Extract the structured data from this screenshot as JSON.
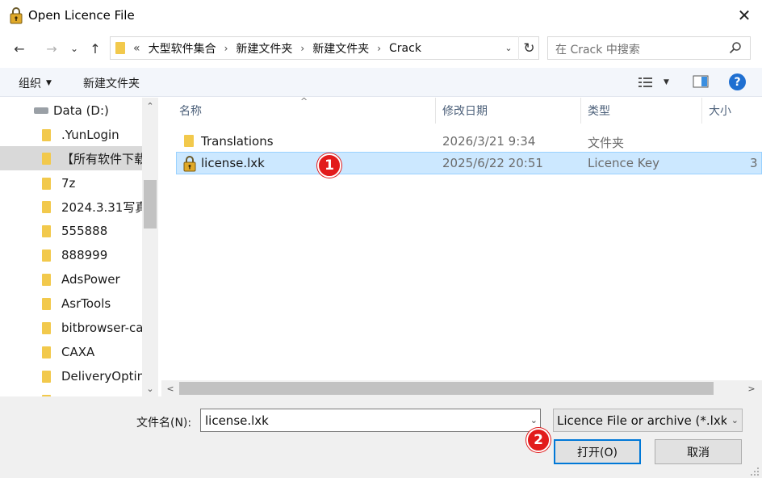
{
  "window": {
    "title": "Open Licence File",
    "close_glyph": "✕"
  },
  "nav": {
    "back_glyph": "←",
    "forward_glyph": "→",
    "recent_glyph": "⌄",
    "up_glyph": "↑"
  },
  "address": {
    "overflow": "«",
    "crumbs": [
      "大型软件集合",
      "新建文件夹",
      "新建文件夹",
      "Crack"
    ],
    "separator": "›",
    "dropdown_glyph": "⌄",
    "refresh_glyph": "↻"
  },
  "search": {
    "placeholder": "在 Crack 中搜索"
  },
  "toolbar": {
    "organize_label": "组织",
    "organize_caret": "▼",
    "new_folder_label": "新建文件夹",
    "help_label": "?"
  },
  "navpane": {
    "drive_label": "Data (D:)",
    "folders": [
      ".YunLogin",
      "【所有软件下载",
      "7z",
      "2024.3.31写真",
      "555888",
      "888999",
      "AdsPower",
      "AsrTools",
      "bitbrowser-ca",
      "CAXA",
      "DeliveryOptin",
      "..."
    ],
    "selected_index": 1,
    "scroll_up": "⌃",
    "scroll_down": "⌄"
  },
  "filelist": {
    "columns": [
      "名称",
      "修改日期",
      "类型",
      "大小"
    ],
    "sort_caret": "^",
    "rows": [
      {
        "name": "Translations",
        "modified": "2026/3/21 9:34",
        "type": "文件夹",
        "size": "",
        "icon": "folder-icon",
        "selected": false
      },
      {
        "name": "license.lxk",
        "modified": "2025/6/22 20:51",
        "type": "Licence Key",
        "size": "3",
        "icon": "lock-file-icon",
        "selected": true
      }
    ],
    "scroll_left": "<",
    "scroll_right": ">"
  },
  "annotations": {
    "badge1": "1",
    "badge2": "2"
  },
  "footer": {
    "filename_label": "文件名(N):",
    "filename_value": "license.lxk",
    "filter_value": "Licence File or archive (*.lxk *",
    "dropdown_glyph": "⌄",
    "open_label": "打开(O)",
    "cancel_label": "取消"
  },
  "colors": {
    "accent": "#0078d7",
    "selected_row": "#cce8ff",
    "badge": "#e21b1b",
    "folder": "#f2c94c"
  }
}
